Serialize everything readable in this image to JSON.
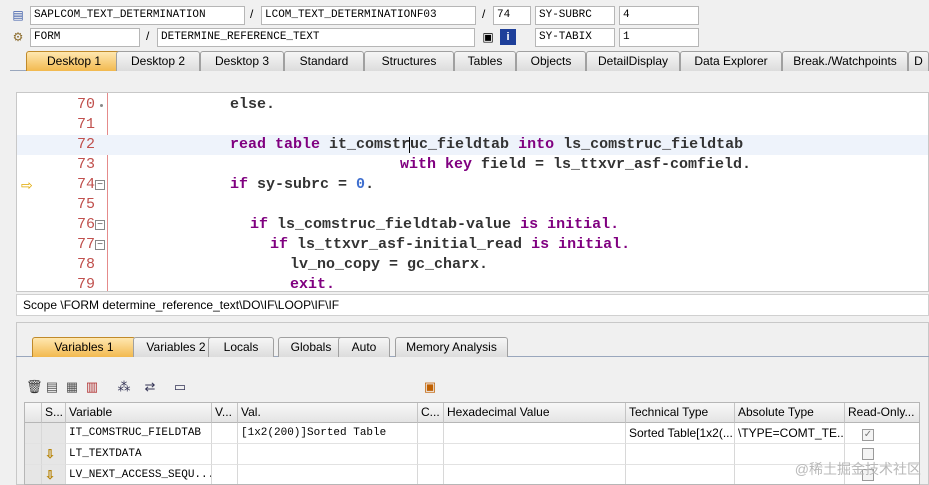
{
  "header": {
    "row1": {
      "program": "SAPLCOM_TEXT_DETERMINATION",
      "include": "LCOM_TEXT_DETERMINATIONF03",
      "line": "74",
      "var_name": "SY-SUBRC",
      "var_value": "4"
    },
    "row2": {
      "event_type": "FORM",
      "event_name": "DETERMINE_REFERENCE_TEXT",
      "var_name": "SY-TABIX",
      "var_value": "1"
    },
    "sep": "/"
  },
  "desktop_tabs": [
    "Desktop 1",
    "Desktop 2",
    "Desktop 3",
    "Standard",
    "Structures",
    "Tables",
    "Objects",
    "DetailDisplay",
    "Data Explorer",
    "Break./Watchpoints",
    "D"
  ],
  "code_lines": [
    {
      "num": "70",
      "text": "             else."
    },
    {
      "num": "71",
      "text": ""
    },
    {
      "num": "72",
      "text": ""
    },
    {
      "num": "73",
      "text": ""
    },
    {
      "num": "74",
      "text": ""
    },
    {
      "num": "75",
      "text": ""
    },
    {
      "num": "76",
      "text": ""
    },
    {
      "num": "77",
      "text": ""
    },
    {
      "num": "78",
      "text": ""
    },
    {
      "num": "79",
      "text": ""
    }
  ],
  "code_tokens": {
    "l72_a": "read table",
    "l72_b": " it_comstruc_fieldtab ",
    "l72_c": "into",
    "l72_d": " ls_comstruc_fieldtab",
    "l73_a": "with key",
    "l73_b": " field = ls_ttxvr_asf-comfield.",
    "l74_a": "if",
    "l74_b": " sy-subrc = ",
    "l74_c": "0",
    "l74_d": ".",
    "l76_a": "if",
    "l76_b": " ls_comstruc_fieldtab-value ",
    "l76_c": "is initial.",
    "l77_a": "if",
    "l77_b": " ls_ttxvr_asf-initial_read ",
    "l77_c": "is initial.",
    "l78_a": "lv_no_copy = gc_charx.",
    "l79_a": "exit."
  },
  "scope_text": "Scope \\FORM determine_reference_text\\DO\\IF\\LOOP\\IF\\IF",
  "variable_tabs": [
    "Variables 1",
    "Variables 2",
    "Locals",
    "Globals",
    "Auto",
    "Memory Analysis"
  ],
  "grid": {
    "headers": [
      "S...",
      "Variable",
      "V...",
      "Val.",
      "C...",
      "Hexadecimal Value",
      "Technical Type",
      "Absolute Type",
      "Read-Only..."
    ],
    "rows": [
      {
        "variable": "IT_COMSTRUC_FIELDTAB",
        "value": "[1x2(200)]Sorted Table",
        "tech_type": "Sorted Table[1x2(...",
        "abs_type": "\\TYPE=COMT_TE..."
      },
      {
        "variable": "LT_TEXTDATA",
        "value": "",
        "tech_type": "",
        "abs_type": ""
      },
      {
        "variable": "LV_NEXT_ACCESS_SEQU...",
        "value": "",
        "tech_type": "",
        "abs_type": ""
      }
    ]
  },
  "watermark": "@稀土掘金技术社区",
  "colors": {
    "active_tab": "#f2b94f",
    "line_number": "#c0504d",
    "keyword": "#800080",
    "number": "#3f6fcf"
  }
}
